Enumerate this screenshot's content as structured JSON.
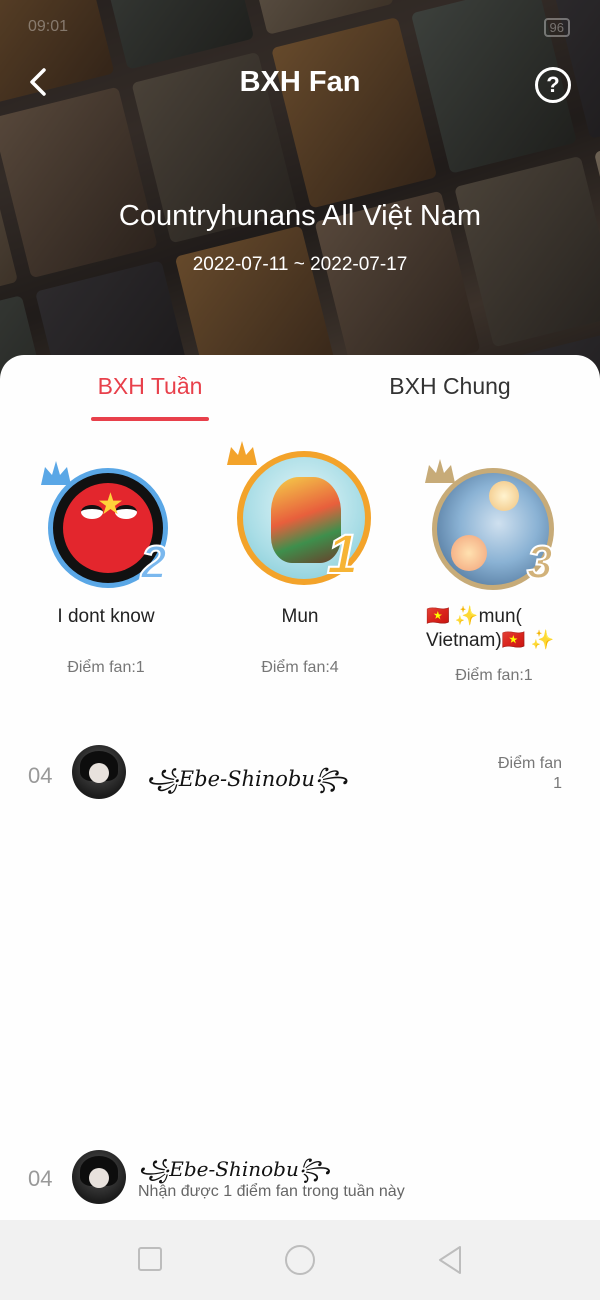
{
  "status_bar": {
    "time": "09:01",
    "battery": "96"
  },
  "header": {
    "title": "BXH Fan",
    "back_icon": "chevron-left-icon",
    "help_icon": "question-circle-icon",
    "help_glyph": "?",
    "group_name": "Countryhunans All Việt Nam",
    "date_range": "2022-07-11 ~ 2022-07-17"
  },
  "tabs": [
    {
      "label": "BXH Tuần",
      "active": true
    },
    {
      "label": "BXH Chung",
      "active": false
    }
  ],
  "podium": {
    "first": {
      "rank": "1",
      "name": "Mun",
      "points": "Điểm fan:4",
      "ring_color": "#f3a32a"
    },
    "second": {
      "rank": "2",
      "name": "I dont know",
      "points": "Điểm fan:1",
      "ring_color": "#5aa7e6"
    },
    "third": {
      "rank": "3",
      "name": "🇻🇳 ✨mun( Vietnam)🇻🇳 ✨",
      "points": "Điểm fan:1",
      "ring_color": "#c7ab78"
    }
  },
  "list": [
    {
      "rank": "04",
      "name": "꧁Ebe-Shinobu꧂",
      "points_label": "Điểm fan",
      "points_value": "1"
    }
  ],
  "my_rank": {
    "rank": "04",
    "name": "꧁Ebe-Shinobu꧂",
    "note": "Nhận được 1 điểm fan trong tuần này"
  },
  "colors": {
    "accent": "#e8404b"
  }
}
